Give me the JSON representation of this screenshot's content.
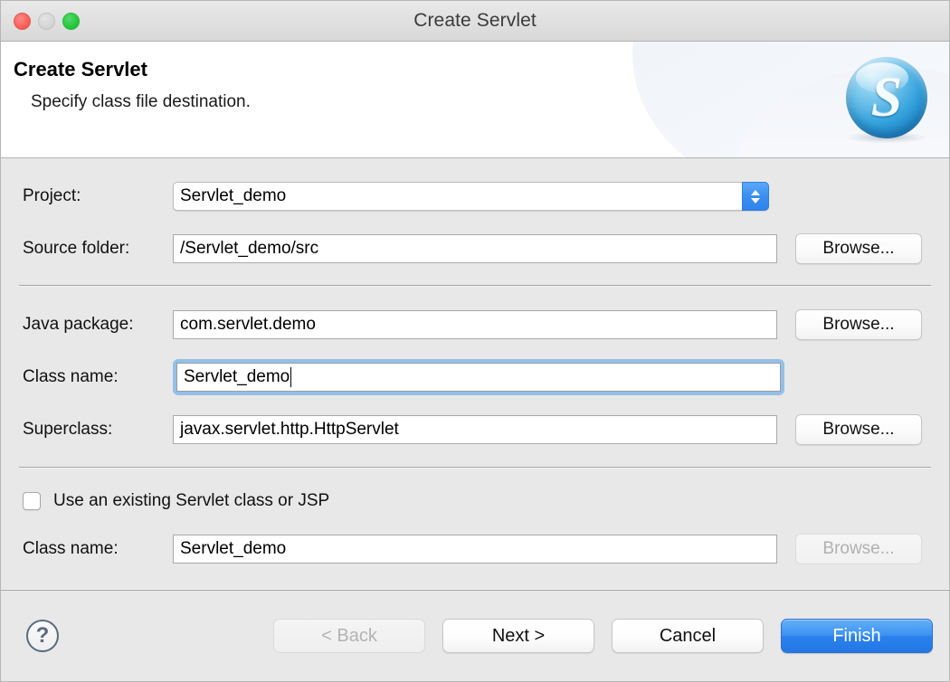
{
  "window": {
    "title": "Create Servlet",
    "traffic_lights": {
      "close": "close-button",
      "minimize": "minimize-button",
      "zoom": "zoom-button"
    }
  },
  "header": {
    "title": "Create Servlet",
    "subtitle": "Specify class file destination.",
    "logo_letter": "S"
  },
  "form": {
    "project": {
      "label": "Project:",
      "value": "Servlet_demo"
    },
    "source_folder": {
      "label": "Source folder:",
      "value": "/Servlet_demo/src",
      "browse_label": "Browse..."
    },
    "java_package": {
      "label": "Java package:",
      "value": "com.servlet.demo",
      "browse_label": "Browse..."
    },
    "class_name": {
      "label": "Class name:",
      "value": "Servlet_demo"
    },
    "superclass": {
      "label": "Superclass:",
      "value": "javax.servlet.http.HttpServlet",
      "browse_label": "Browse..."
    },
    "use_existing": {
      "label": "Use an existing Servlet class or JSP",
      "checked": false
    },
    "existing_class_name": {
      "label": "Class name:",
      "value": "Servlet_demo",
      "browse_label": "Browse...",
      "browse_disabled": true
    }
  },
  "footer": {
    "help_label": "?",
    "back_label": "< Back",
    "next_label": "Next >",
    "cancel_label": "Cancel",
    "finish_label": "Finish"
  },
  "colors": {
    "accent": "#2b81ec",
    "focus_ring": "#93c0e8",
    "window_bg": "#e8e8e8",
    "titlebar_bg": "#e0e0e0",
    "close": "#fb5f57",
    "minimize": "#d5d5d5",
    "zoom": "#24c63c"
  }
}
